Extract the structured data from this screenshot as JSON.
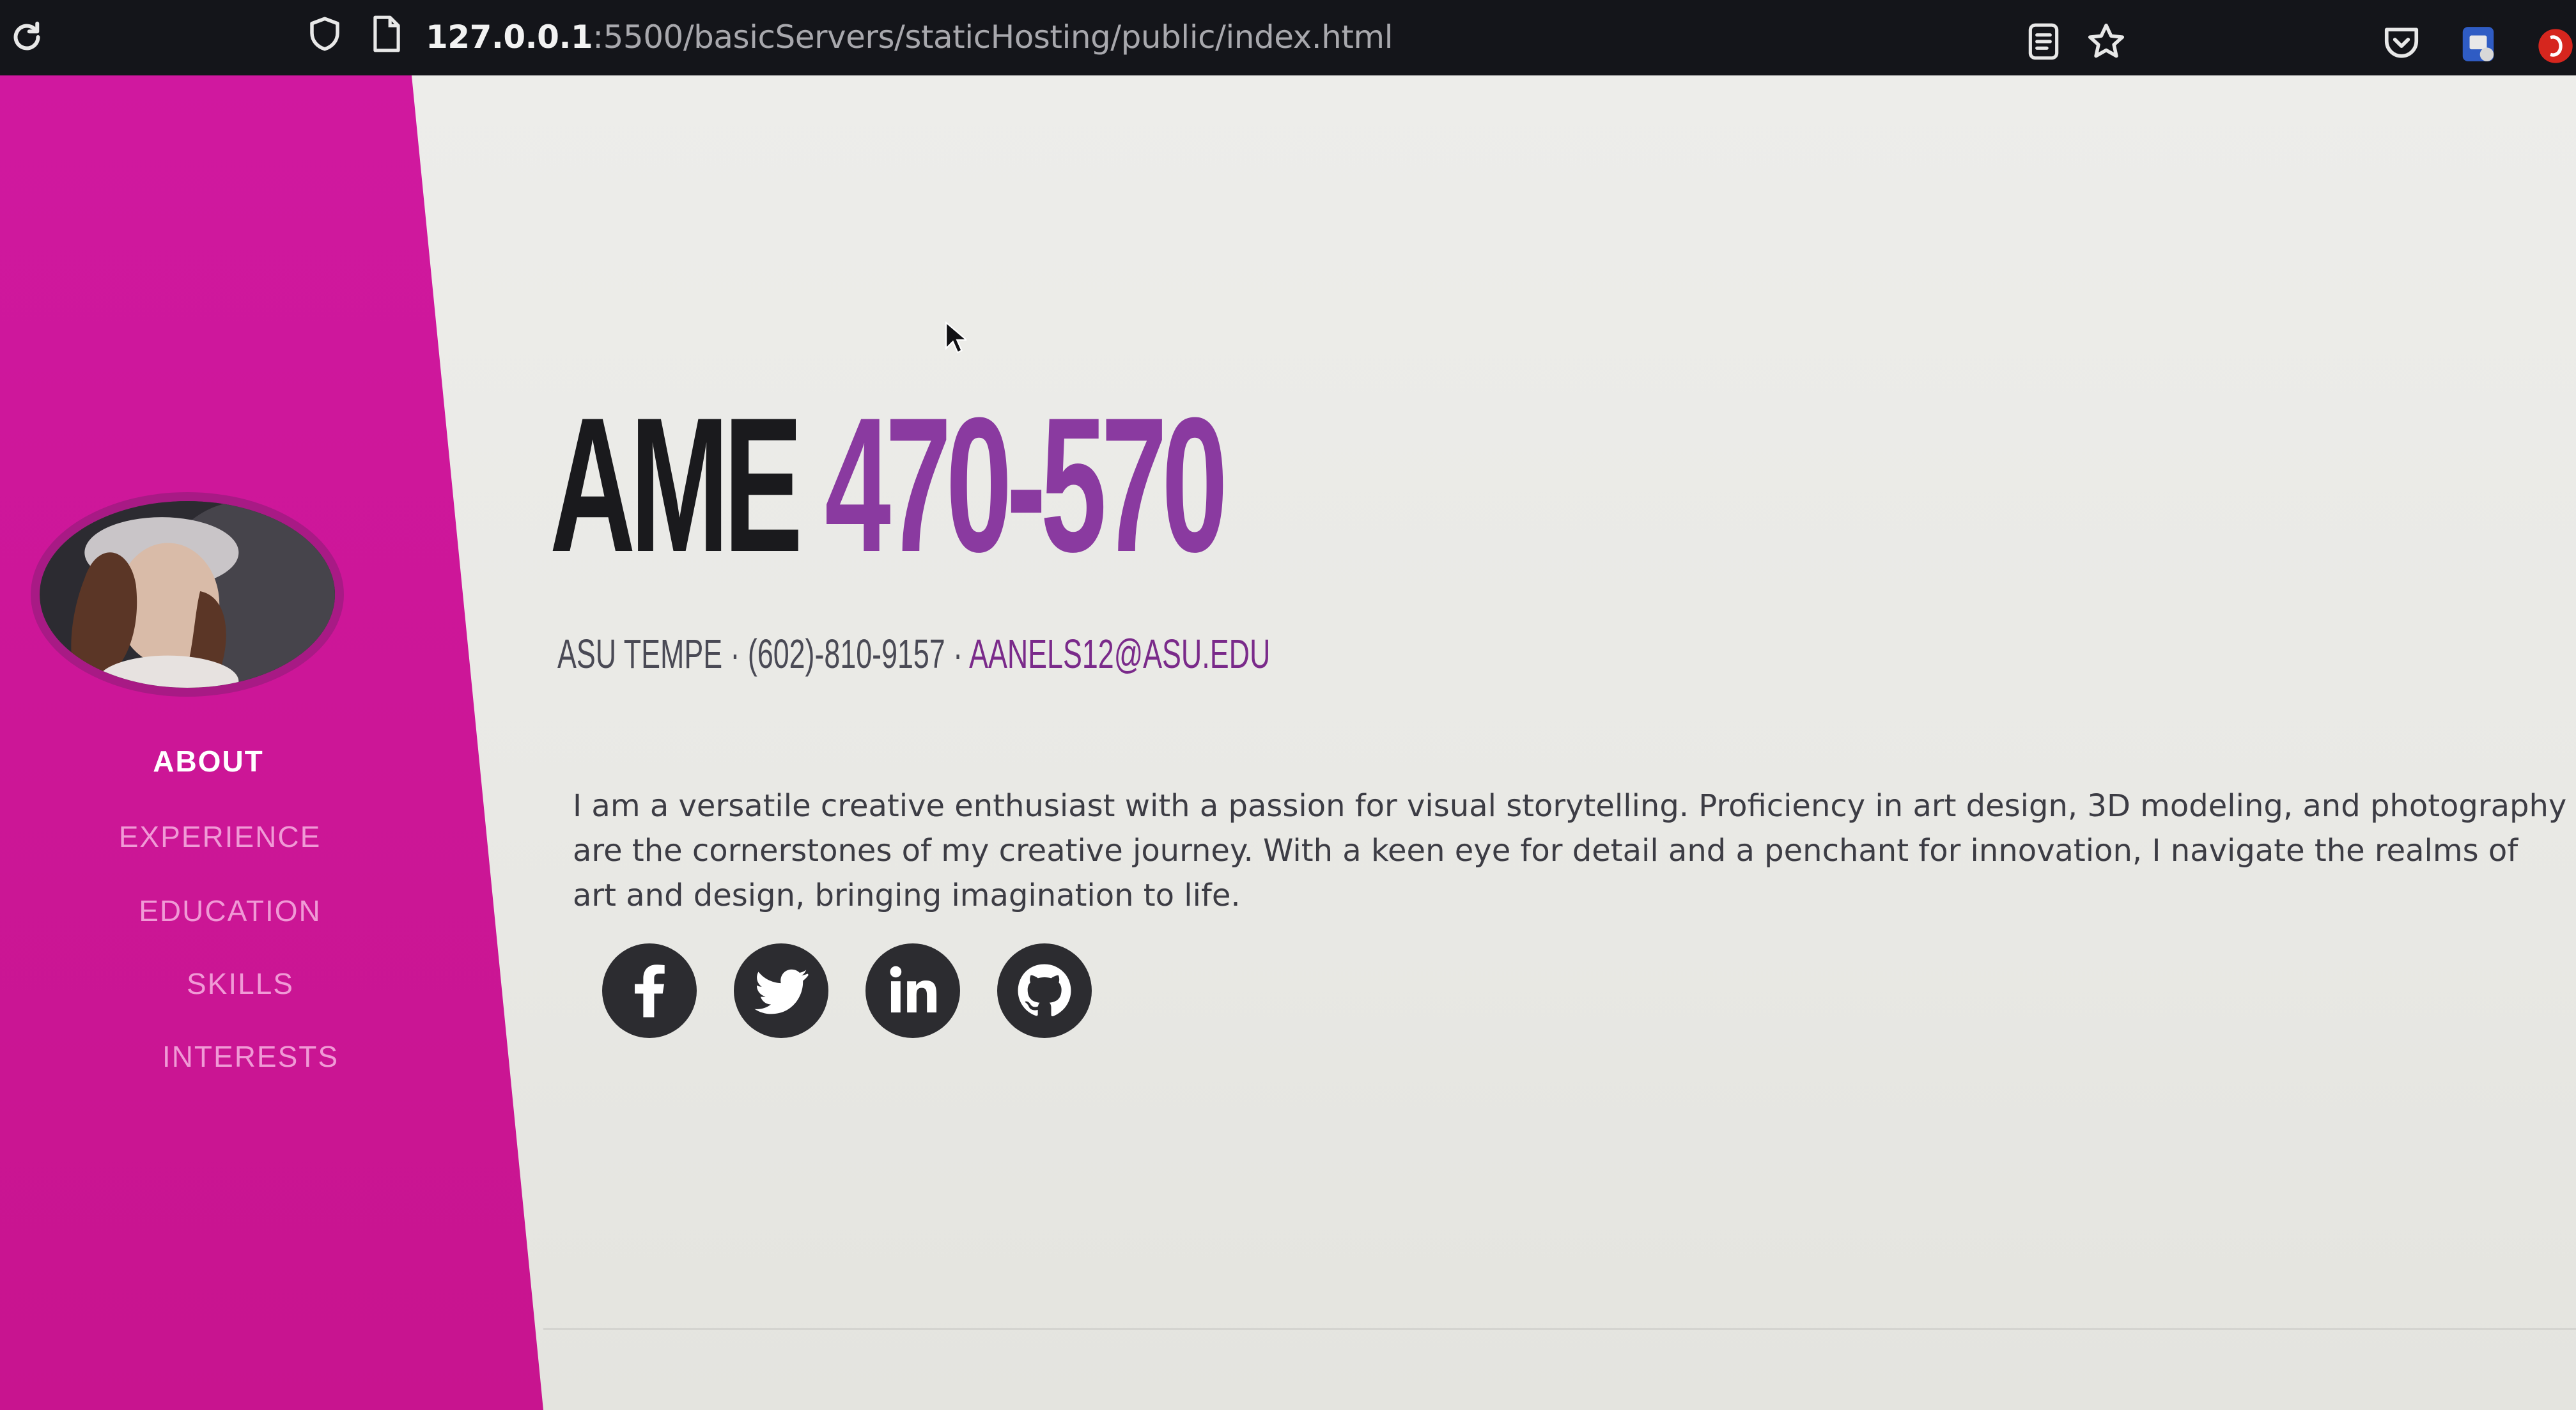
{
  "browser": {
    "url_host": "127.0.0.1",
    "url_path": ":5500/basicServers/staticHosting/public/index.html",
    "icons": [
      "reload-icon",
      "shield-icon",
      "page-icon",
      "reader-view-icon",
      "bookmark-star-icon",
      "pocket-icon",
      "extension-icon",
      "profile-icon"
    ]
  },
  "sidebar": {
    "background": "#cc1596",
    "nav": [
      {
        "label": "ABOUT",
        "active": true
      },
      {
        "label": "EXPERIENCE",
        "active": false
      },
      {
        "label": "EDUCATION",
        "active": false
      },
      {
        "label": "SKILLS",
        "active": false
      },
      {
        "label": "INTERESTS",
        "active": false
      }
    ]
  },
  "header": {
    "title_first": "AME",
    "title_last": "470-570",
    "subheading_text": "ASU TEMPE · (602)-810-9157 · ",
    "email": "AANELS12@ASU.EDU"
  },
  "bio": "I am a versatile creative enthusiast with a passion for visual storytelling. Proficiency in art design, 3D modeling, and photography are the cornerstones of my creative journey. With a keen eye for detail and a penchant for innovation, I navigate the realms of art and design, bringing imagination to life.",
  "social_icons": [
    "facebook-icon",
    "twitter-icon",
    "linkedin-icon",
    "github-icon"
  ],
  "colors": {
    "accent_purple": "#8a3aa0",
    "sidebar_magenta": "#cc1596",
    "page_bg": "#ebebe8"
  }
}
